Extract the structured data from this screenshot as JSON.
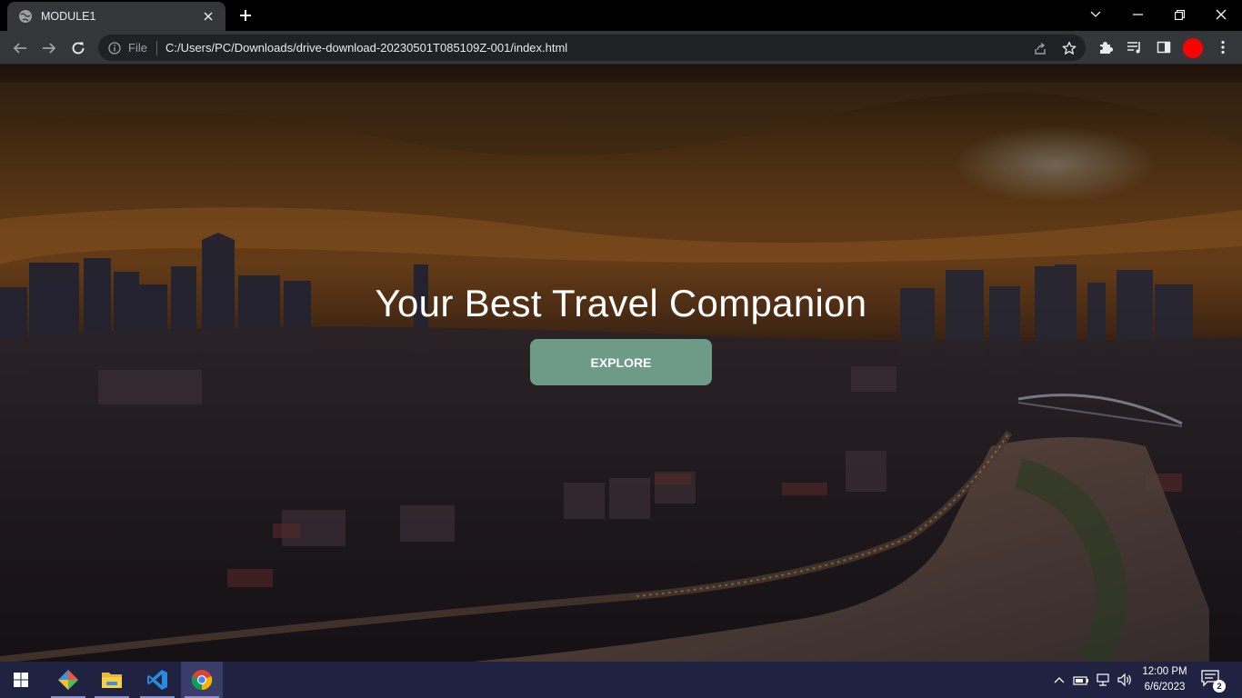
{
  "browser": {
    "tab_title": "MODULE1",
    "omnibox_scheme_label": "File",
    "url": "C:/Users/PC/Downloads/drive-download-20230501T085109Z-001/index.html",
    "profile_color": "#ff0000"
  },
  "page": {
    "hero_title": "Your Best Travel Companion",
    "explore_label": "EXPLORE",
    "accent_color": "#6e9a88"
  },
  "taskbar": {
    "apps": [
      "start-icon",
      "git-icon",
      "file-explorer-icon",
      "vscode-icon",
      "chrome-icon"
    ],
    "time": "12:00 PM",
    "date": "6/6/2023",
    "notification_count": "2"
  }
}
